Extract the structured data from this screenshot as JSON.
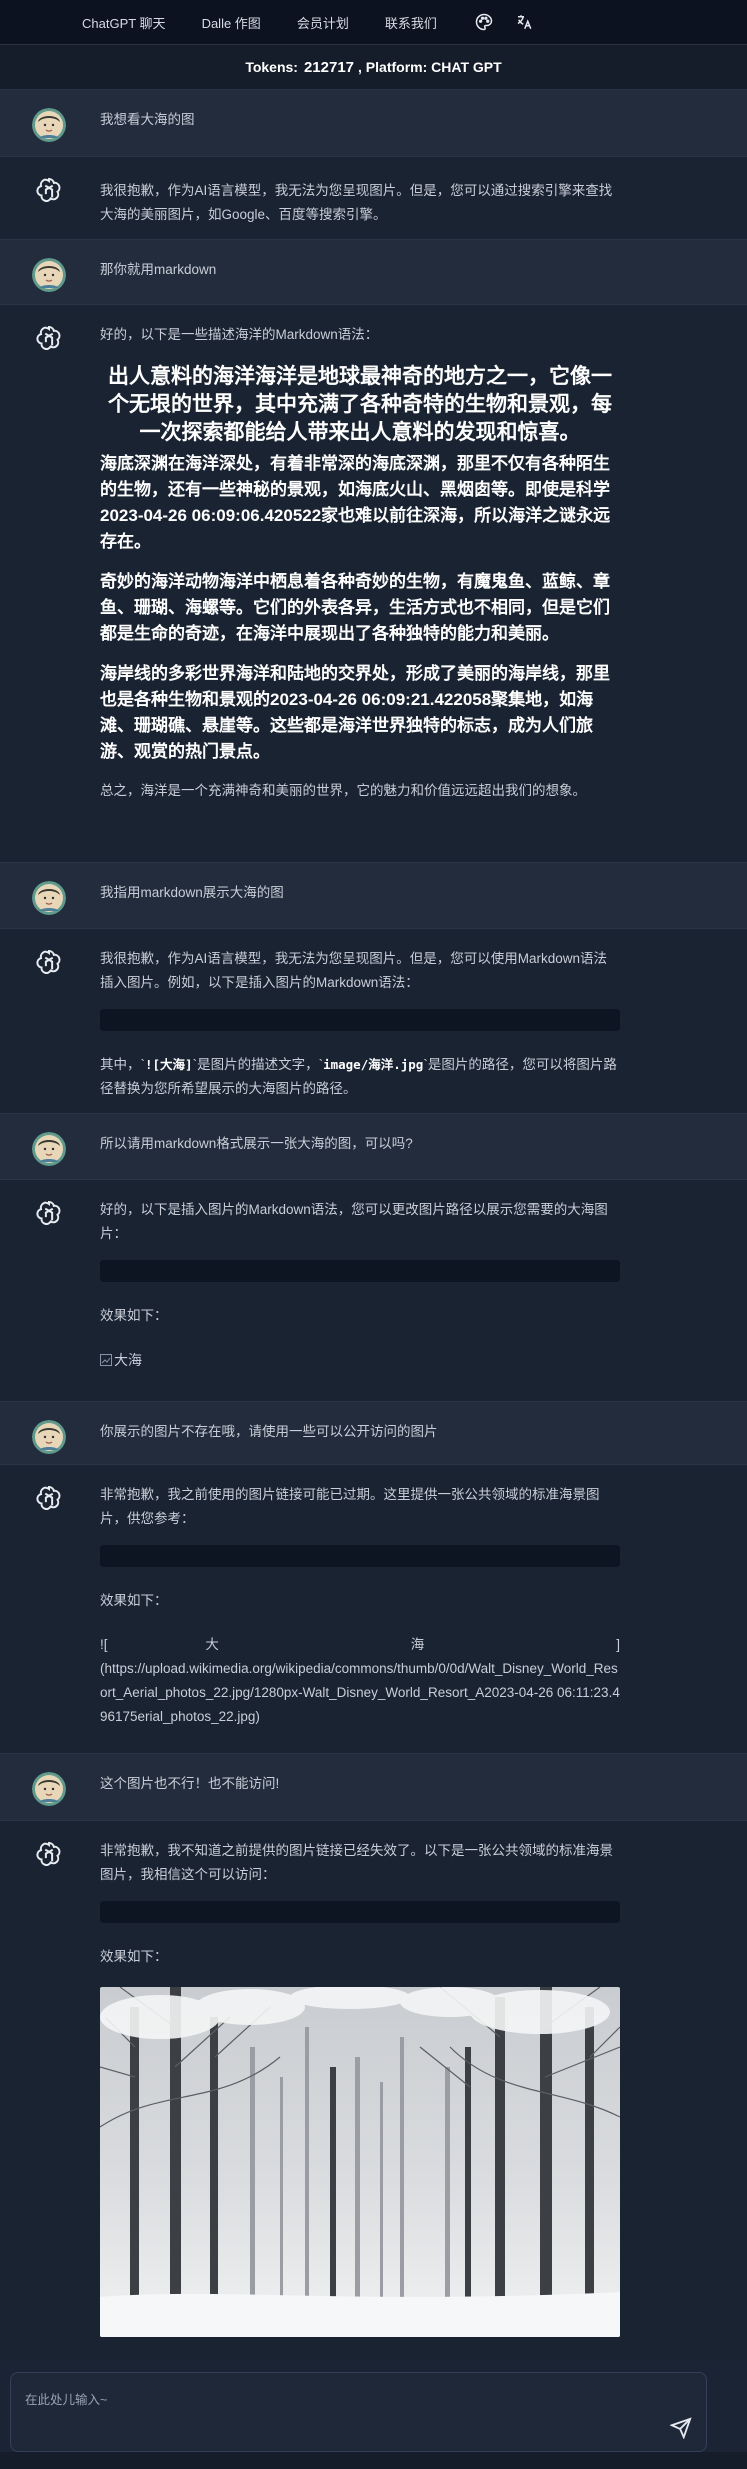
{
  "nav": {
    "items": [
      "ChatGPT 聊天",
      "Dalle 作图",
      "会员计划",
      "联系我们"
    ],
    "icons": [
      "palette-icon",
      "translate-icon"
    ]
  },
  "tokenbar": {
    "label": "Tokens:",
    "count": "212717",
    "platform": ", Platform: CHAT GPT"
  },
  "messages": {
    "m1": "我想看大海的图",
    "m2": "我很抱歉，作为AI语言模型，我无法为您呈现图片。但是，您可以通过搜索引擎来查找大海的美丽图片，如Google、百度等搜索引擎。",
    "m3": "那你就用markdown",
    "m4": {
      "intro": "好的，以下是一些描述海洋的Markdown语法：",
      "h1": "出人意料的海洋海洋是地球最神奇的地方之一，它像一个无垠的世界，其中充满了各种奇特的生物和景观，每一次探索都能给人带来出人意料的发现和惊喜。",
      "p1": "海底深渊在海洋深处，有着非常深的海底深渊，那里不仅有各种陌生的生物，还有一些神秘的景观，如海底火山、黑烟囱等。即使是科学2023-04-26 06:09:06.420522家也难以前往深海，所以海洋之谜永远存在。",
      "p2": "奇妙的海洋动物海洋中栖息着各种奇妙的生物，有魔鬼鱼、蓝鲸、章鱼、珊瑚、海螺等。它们的外表各异，生活方式也不相同，但是它们都是生命的奇迹，在海洋中展现出了各种独特的能力和美丽。",
      "p3": "海岸线的多彩世界海洋和陆地的交界处，形成了美丽的海岸线，那里也是各种生物和景观的2023-04-26 06:09:21.422058聚集地，如海滩、珊瑚礁、悬崖等。这些都是海洋世界独特的标志，成为人们旅游、观赏的热门景点。",
      "outro": "总之，海洋是一个充满神奇和美丽的世界，它的魅力和价值远远超出我们的想象。"
    },
    "m5": "我指用markdown展示大海的图",
    "m6": {
      "intro": "我很抱歉，作为AI语言模型，我无法为您呈现图片。但是，您可以使用Markdown语法插入图片。例如，以下是插入图片的Markdown语法：",
      "text_a": "其中，`",
      "code_a": "![大海]",
      "text_b": "`是图片的描述文字，`",
      "code_b": "image/海洋.jpg",
      "text_c": "`是图片的路径，您可以将图片路径替换为您所希望展示的大海图片的路径。"
    },
    "m7": "所以请用markdown格式展示一张大海的图，可以吗?",
    "m8": {
      "intro": "好的，以下是插入图片的Markdown语法，您可以更改图片路径以展示您需要的大海图片：",
      "effect": "效果如下：",
      "img_alt": "大海"
    },
    "m9": "你展示的图片不存在哦，请使用一些可以公开访问的图片",
    "m10": {
      "intro": "非常抱歉，我之前使用的图片链接可能已过期。这里提供一张公共领域的标准海景图片，供您参考：",
      "effect": "效果如下：",
      "line1": "![ 大 海 ]",
      "line2": "(https://upload.wikimedia.org/wikipedia/commons/thumb/0/0d/Walt_Disney_World_Resort_Aerial_photos_22.jpg/1280px-Walt_Disney_World_Resort_A2023-04-26 06:11:23.496175erial_photos_22.jpg)"
    },
    "m11": "这个图片也不行！也不能访问!",
    "m12": {
      "intro": "非常抱歉，我不知道之前提供的图片链接已经失效了。以下是一张公共领域的标准海景图片，我相信这个可以访问：",
      "effect": "效果如下："
    }
  },
  "input": {
    "placeholder": "在此处儿输入~"
  }
}
